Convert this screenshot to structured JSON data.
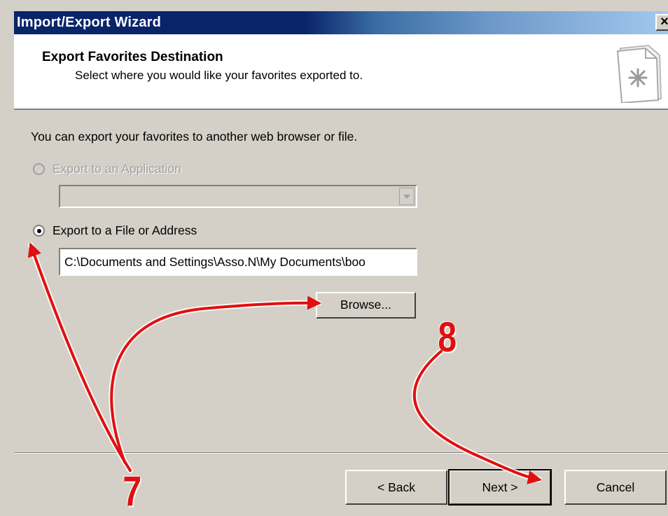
{
  "window": {
    "title": "Import/Export Wizard",
    "close_label": "×"
  },
  "header": {
    "title": "Export Favorites Destination",
    "subtitle": "Select where you would like your favorites exported to."
  },
  "body": {
    "intro": "You can export your favorites to another web browser or file.",
    "option_application": {
      "label": "Export to an Application",
      "selected": false,
      "enabled": false
    },
    "option_file": {
      "label": "Export to a File or Address",
      "selected": true,
      "path_value": "C:\\Documents and Settings\\Asso.N\\My Documents\\boo"
    },
    "browse_label": "Browse..."
  },
  "footer": {
    "back_label": "< Back",
    "next_label": "Next >",
    "cancel_label": "Cancel"
  },
  "annotations": {
    "step7": "7",
    "step8": "8",
    "arrow_color": "#e01010"
  },
  "colors": {
    "title_gradient_start": "#0a246a",
    "title_gradient_end": "#a6caf0",
    "dialog_face": "#d4d0c8"
  },
  "icons": {
    "header_icon": "favorites-document-icon"
  }
}
